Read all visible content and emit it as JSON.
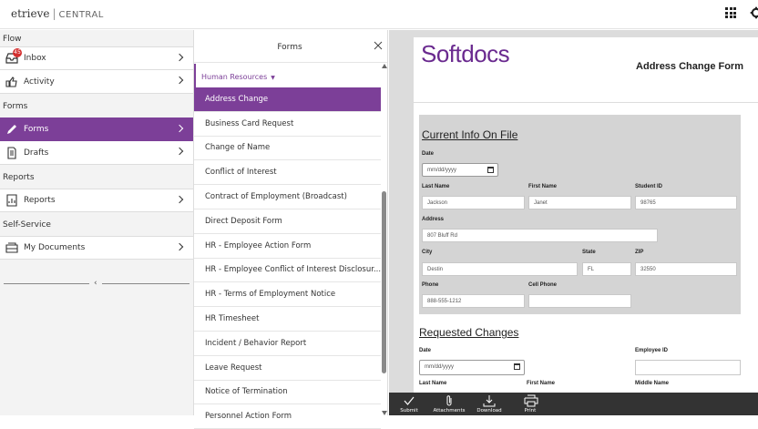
{
  "header": {
    "brand": "etrieve",
    "product": "CENTRAL"
  },
  "sidebar": {
    "sections": [
      {
        "title": "Flow",
        "items": [
          {
            "label": "Inbox",
            "icon": "inbox-icon",
            "badge": "45"
          },
          {
            "label": "Activity",
            "icon": "activity-icon"
          }
        ]
      },
      {
        "title": "Forms",
        "items": [
          {
            "label": "Forms",
            "icon": "pencil-icon",
            "active": true
          },
          {
            "label": "Drafts",
            "icon": "drafts-icon"
          }
        ]
      },
      {
        "title": "Reports",
        "items": [
          {
            "label": "Reports",
            "icon": "reports-icon"
          }
        ]
      },
      {
        "title": "Self-Service",
        "items": [
          {
            "label": "My Documents",
            "icon": "documents-icon"
          }
        ]
      }
    ]
  },
  "forms_panel": {
    "title": "Forms",
    "category": "Human Resources",
    "items": [
      "Address Change",
      "Business Card Request",
      "Change of Name",
      "Conflict of Interest",
      "Contract of Employment (Broadcast)",
      "Direct Deposit Form",
      "HR - Employee Action Form",
      "HR - Employee Conflict of Interest Disclosur...",
      "HR - Terms of Employment Notice",
      "HR Timesheet",
      "Incident / Behavior Report",
      "Leave Request",
      "Notice of Termination",
      "Personnel Action Form"
    ],
    "active_index": 0
  },
  "document": {
    "logo": "Softdocs",
    "title": "Address Change Form",
    "current": {
      "heading": "Current Info On File",
      "date_label": "Date",
      "date_placeholder": "mm/dd/yyyy",
      "last_name_label": "Last Name",
      "last_name": "Jackson",
      "first_name_label": "First Name",
      "first_name": "Janet",
      "student_id_label": "Student ID",
      "student_id": "98765",
      "address_label": "Address",
      "address": "807 Bluff Rd",
      "city_label": "City",
      "city": "Destin",
      "state_label": "State",
      "state": "FL",
      "zip_label": "ZIP",
      "zip": "32550",
      "phone_label": "Phone",
      "phone": "888-555-1212",
      "cell_label": "Cell Phone",
      "cell": ""
    },
    "requested": {
      "heading": "Requested Changes",
      "date_label": "Date",
      "date_placeholder": "mm/dd/yyyy",
      "employee_id_label": "Employee ID",
      "last_name_label": "Last Name",
      "first_name_label": "First Name",
      "middle_name_label": "Middle Name"
    }
  },
  "toolbar": {
    "submit": "Submit",
    "attachments": "Attachments",
    "download": "Download",
    "print": "Print"
  },
  "colors": {
    "accent": "#7c3f98",
    "toolbar": "#333333"
  }
}
